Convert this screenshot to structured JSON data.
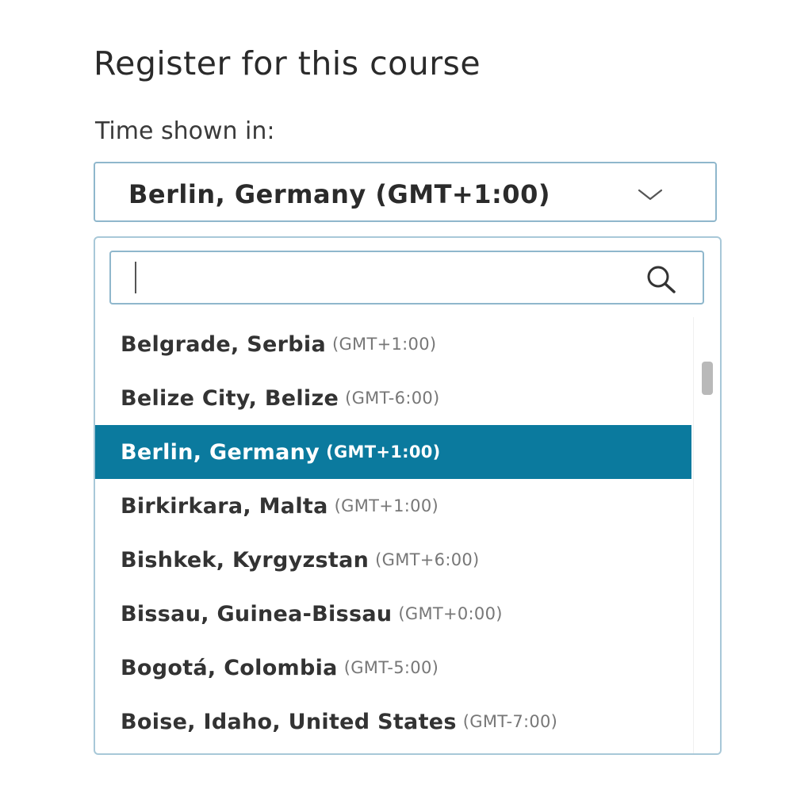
{
  "register": {
    "title": "Register for this course",
    "time_label": "Time shown in:"
  },
  "timezone_select": {
    "selected_value": "Berlin, Germany (GMT+1:00)",
    "icon": "chevron-down-icon"
  },
  "dropdown": {
    "search": {
      "value": "",
      "placeholder": "",
      "icon": "search-icon"
    },
    "options": [
      {
        "city": "Belgrade, Serbia",
        "offset": "(GMT+1:00)",
        "selected": false
      },
      {
        "city": "Belize City, Belize",
        "offset": "(GMT-6:00)",
        "selected": false
      },
      {
        "city": "Berlin, Germany",
        "offset": "(GMT+1:00)",
        "selected": true
      },
      {
        "city": "Birkirkara, Malta",
        "offset": "(GMT+1:00)",
        "selected": false
      },
      {
        "city": "Bishkek, Kyrgyzstan",
        "offset": "(GMT+6:00)",
        "selected": false
      },
      {
        "city": "Bissau, Guinea-Bissau",
        "offset": "(GMT+0:00)",
        "selected": false
      },
      {
        "city": "Bogotá, Colombia",
        "offset": "(GMT-5:00)",
        "selected": false
      },
      {
        "city": "Boise, Idaho, United States",
        "offset": "(GMT-7:00)",
        "selected": false
      }
    ]
  },
  "colors": {
    "accent": "#0b7a9e",
    "border": "#8fb7cc",
    "text": "#2b2b2b",
    "muted": "#777777"
  }
}
